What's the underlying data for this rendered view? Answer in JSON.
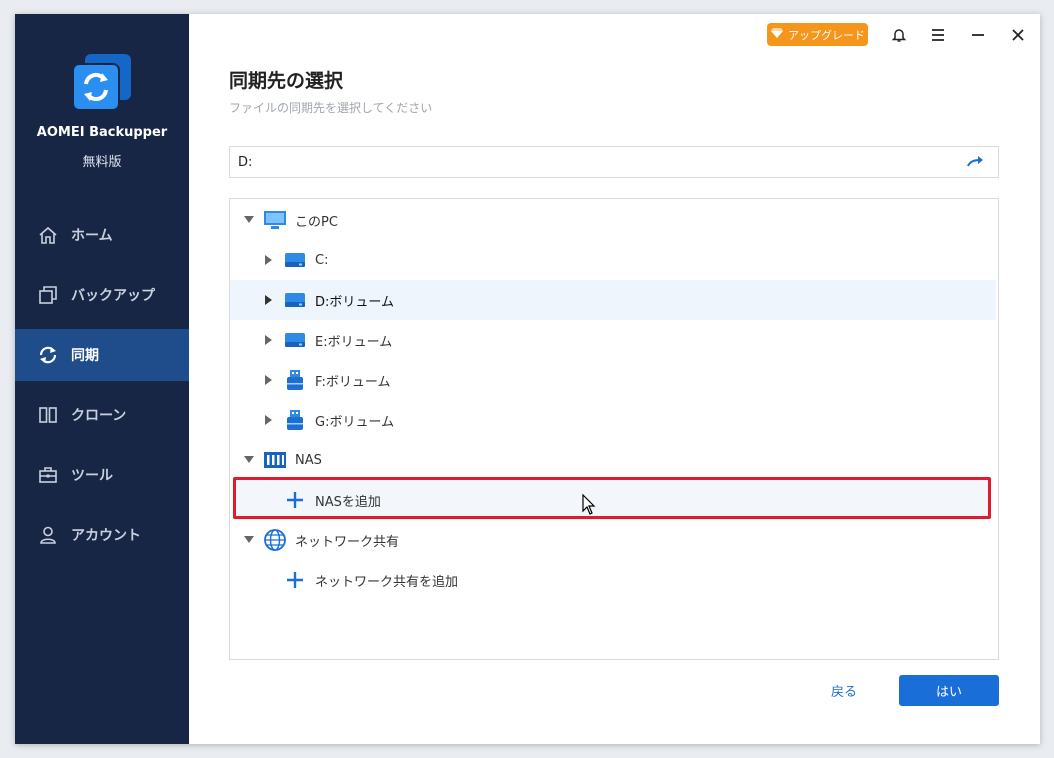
{
  "app": {
    "name": "AOMEI Backupper",
    "edition": "無料版"
  },
  "sidebar": {
    "items": [
      {
        "label": "ホーム",
        "icon": "home-icon",
        "active": false
      },
      {
        "label": "バックアップ",
        "icon": "backup-icon",
        "active": false
      },
      {
        "label": "同期",
        "icon": "sync-icon",
        "active": true
      },
      {
        "label": "クローン",
        "icon": "clone-icon",
        "active": false
      },
      {
        "label": "ツール",
        "icon": "tools-icon",
        "active": false
      },
      {
        "label": "アカウント",
        "icon": "account-icon",
        "active": false
      }
    ]
  },
  "titlebar": {
    "upgrade_label": "アップグレード"
  },
  "page": {
    "title": "同期先の選択",
    "subtitle": "ファイルの同期先を選択してください"
  },
  "path": {
    "value": "D:"
  },
  "tree": {
    "pc_label": "このPC",
    "drives": [
      {
        "label": "C:",
        "type": "hdd"
      },
      {
        "label": "D:ボリューム",
        "type": "hdd",
        "selected": true
      },
      {
        "label": "E:ボリューム",
        "type": "hdd"
      },
      {
        "label": "F:ボリューム",
        "type": "usb"
      },
      {
        "label": "G:ボリューム",
        "type": "usb"
      }
    ],
    "nas_label": "NAS",
    "add_nas_label": "NASを追加",
    "network_label": "ネットワーク共有",
    "add_network_label": "ネットワーク共有を追加"
  },
  "buttons": {
    "back": "戻る",
    "ok": "はい"
  },
  "colors": {
    "sidebar_bg": "#172645",
    "sidebar_active": "#1f4d8c",
    "accent": "#1a6ed8",
    "upgrade": "#f6951c",
    "highlight": "#e01b2b"
  }
}
